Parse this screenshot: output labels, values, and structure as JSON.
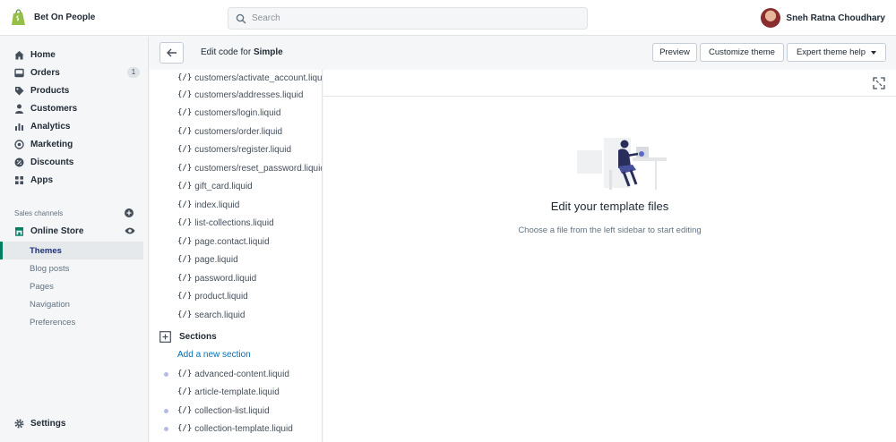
{
  "store": {
    "name": "Bet On People"
  },
  "search": {
    "placeholder": "Search"
  },
  "user": {
    "name": "Sneh Ratna Choudhary"
  },
  "nav": {
    "items": [
      {
        "label": "Home",
        "icon": "home-icon"
      },
      {
        "label": "Orders",
        "icon": "orders-icon",
        "badge": "1"
      },
      {
        "label": "Products",
        "icon": "tag-icon"
      },
      {
        "label": "Customers",
        "icon": "person-icon"
      },
      {
        "label": "Analytics",
        "icon": "bar-chart-icon"
      },
      {
        "label": "Marketing",
        "icon": "target-icon"
      },
      {
        "label": "Discounts",
        "icon": "discount-icon"
      },
      {
        "label": "Apps",
        "icon": "apps-icon"
      }
    ],
    "sales_channels_label": "Sales channels",
    "online_store": "Online Store",
    "sub_items": [
      "Themes",
      "Blog posts",
      "Pages",
      "Navigation",
      "Preferences"
    ],
    "settings": "Settings"
  },
  "editor": {
    "title_prefix": "Edit code for",
    "theme_name": "Simple",
    "preview": "Preview",
    "customize": "Customize theme",
    "expert_help": "Expert theme help"
  },
  "files": {
    "brace": "{/}",
    "templates": [
      "customers/activate_account.liquid",
      "customers/addresses.liquid",
      "customers/login.liquid",
      "customers/order.liquid",
      "customers/register.liquid",
      "customers/reset_password.liquid",
      "gift_card.liquid",
      "index.liquid",
      "list-collections.liquid",
      "page.contact.liquid",
      "page.liquid",
      "password.liquid",
      "product.liquid",
      "search.liquid"
    ],
    "sections_label": "Sections",
    "add_section": "Add a new section",
    "sections": [
      {
        "name": "advanced-content.liquid",
        "dot": true
      },
      {
        "name": "article-template.liquid",
        "dot": false
      },
      {
        "name": "collection-list.liquid",
        "dot": true
      },
      {
        "name": "collection-template.liquid",
        "dot": true
      }
    ]
  },
  "empty_state": {
    "title": "Edit your template files",
    "subtitle": "Choose a file from the left sidebar to start editing"
  },
  "colors": {
    "accent": "#008060",
    "link": "#006fbb",
    "active_text": "#202e78"
  }
}
